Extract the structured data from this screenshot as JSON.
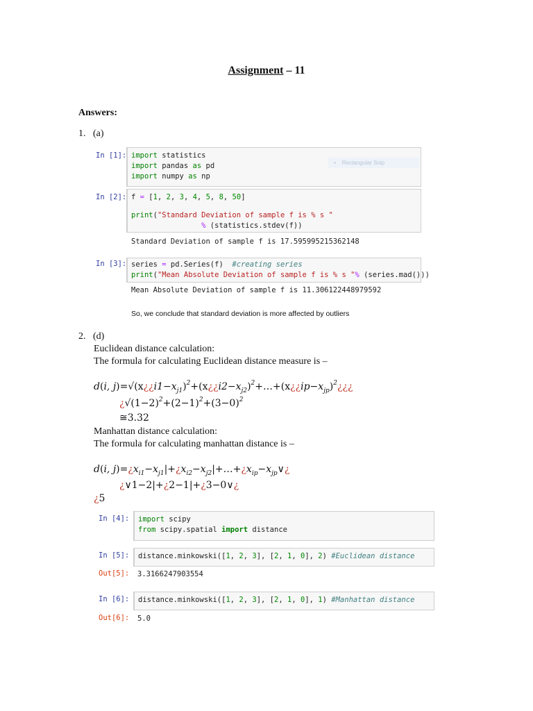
{
  "title": {
    "underlined": "Assignment",
    "rest": " – 11"
  },
  "answers_heading": "Answers:",
  "q1_label": "1.   (a)",
  "cells": {
    "in1": {
      "prompt": "In [1]:",
      "lines": [
        [
          [
            "import",
            "kwn"
          ],
          [
            " statistics",
            ""
          ]
        ],
        [
          [
            "import",
            "kwn"
          ],
          [
            " pandas ",
            ""
          ],
          [
            "as",
            "kwn"
          ],
          [
            " pd",
            ""
          ]
        ],
        [
          [
            "import",
            "kwn"
          ],
          [
            " numpy ",
            ""
          ],
          [
            "as",
            "kwn"
          ],
          [
            " np",
            ""
          ]
        ]
      ]
    },
    "in2": {
      "prompt": "In [2]:",
      "lines": [
        [
          [
            "f ",
            ""
          ],
          [
            "=",
            "op"
          ],
          [
            " [",
            ""
          ],
          [
            "1",
            "num"
          ],
          [
            ", ",
            ""
          ],
          [
            "2",
            "num"
          ],
          [
            ", ",
            ""
          ],
          [
            "3",
            "num"
          ],
          [
            ", ",
            ""
          ],
          [
            "4",
            "num"
          ],
          [
            ", ",
            ""
          ],
          [
            "5",
            "num"
          ],
          [
            ", ",
            ""
          ],
          [
            "8",
            "num"
          ],
          [
            ", ",
            ""
          ],
          [
            "50",
            "num"
          ],
          [
            "]",
            ""
          ]
        ],
        [
          [
            "",
            ""
          ]
        ],
        [
          [
            "print",
            "kwn"
          ],
          [
            "(",
            ""
          ],
          [
            "\"Standard Deviation of sample f is % s \"",
            "str"
          ]
        ],
        [
          [
            "                ",
            ""
          ],
          [
            "%",
            "op"
          ],
          [
            " (statistics.stdev(f))",
            ""
          ]
        ]
      ]
    },
    "out2": "Standard Deviation of sample f is 17.595995215362148",
    "in3": {
      "prompt": "In [3]:",
      "lines": [
        [
          [
            "series ",
            ""
          ],
          [
            "=",
            "op"
          ],
          [
            " pd.Series(f)  ",
            ""
          ],
          [
            "#creating series",
            "cm"
          ]
        ],
        [
          [
            "print",
            "kwn"
          ],
          [
            "(",
            ""
          ],
          [
            "\"Mean Absolute Deviation of sample f is % s \"",
            "str"
          ],
          [
            "%",
            "op"
          ],
          [
            " (series.mad()))",
            ""
          ]
        ]
      ]
    },
    "out3": "Mean Absolute Deviation of sample f is 11.306122448979592",
    "in4": {
      "prompt": "In [4]:",
      "lines": [
        [
          [
            "import",
            "kwn"
          ],
          [
            " scipy",
            ""
          ]
        ],
        [
          [
            "from",
            "kwn"
          ],
          [
            " scipy.spatial ",
            ""
          ],
          [
            "import",
            "kw"
          ],
          [
            " distance",
            ""
          ]
        ]
      ]
    },
    "in5": {
      "prompt": "In [5]:",
      "lines": [
        [
          [
            "distance.minkowski([",
            ""
          ],
          [
            "1",
            "num"
          ],
          [
            ", ",
            ""
          ],
          [
            "2",
            "num"
          ],
          [
            ", ",
            ""
          ],
          [
            "3",
            "num"
          ],
          [
            "], [",
            ""
          ],
          [
            "2",
            "num"
          ],
          [
            ", ",
            ""
          ],
          [
            "1",
            "num"
          ],
          [
            ", ",
            ""
          ],
          [
            "0",
            "num"
          ],
          [
            "], ",
            ""
          ],
          [
            "2",
            "num"
          ],
          [
            ") ",
            ""
          ],
          [
            "#Euclidean distance",
            "cm"
          ]
        ]
      ]
    },
    "out5_prompt": "Out[5]:",
    "out5": "3.3166247903554",
    "in6": {
      "prompt": "In [6]:",
      "lines": [
        [
          [
            "distance.minkowski([",
            ""
          ],
          [
            "1",
            "num"
          ],
          [
            ", ",
            ""
          ],
          [
            "2",
            "num"
          ],
          [
            ", ",
            ""
          ],
          [
            "3",
            "num"
          ],
          [
            "], [",
            ""
          ],
          [
            "2",
            "num"
          ],
          [
            ", ",
            ""
          ],
          [
            "1",
            "num"
          ],
          [
            ", ",
            ""
          ],
          [
            "0",
            "num"
          ],
          [
            "], ",
            ""
          ],
          [
            "1",
            "num"
          ],
          [
            ") ",
            ""
          ],
          [
            "#Manhattan distance",
            "cm"
          ]
        ]
      ]
    },
    "out6_prompt": "Out[6]:",
    "out6": "5.0"
  },
  "snip_overlay": "▪    Rectangular Snip",
  "conclusion": "So, we conclude that standard deviation is more affected by outliers",
  "q2_label": "2.   (d)",
  "euclid_heading": "Euclidean distance calculation:",
  "euclid_formula_intro": "The formula for calculating Euclidean distance measure is –",
  "euclid_formula": [
    [
      [
        "d",
        "",
        ""
      ],
      [
        "(",
        "up"
      ],
      [
        "i, j",
        "",
        ""
      ],
      [
        ")=√(x",
        "up"
      ],
      [
        "¿¿",
        "q"
      ],
      [
        "i1−x",
        "",
        ""
      ],
      [
        "j1",
        "sub"
      ],
      [
        ")",
        "up"
      ],
      [
        "2",
        "sup"
      ],
      [
        "+(x",
        "up"
      ],
      [
        "¿¿",
        "q"
      ],
      [
        "i2−x",
        ""
      ],
      [
        "j2",
        "sub"
      ],
      [
        ")",
        "up"
      ],
      [
        "2",
        "sup"
      ],
      [
        "+…+(x",
        "up"
      ],
      [
        "¿¿",
        "q"
      ],
      [
        "ip−x",
        ""
      ],
      [
        "jp",
        "sub"
      ],
      [
        ")",
        "up"
      ],
      [
        "2",
        "sup"
      ],
      [
        "¿¿¿",
        "q"
      ]
    ],
    [
      [
        "¿",
        "q"
      ],
      [
        "√(1−2)",
        "up"
      ],
      [
        "2",
        "sup"
      ],
      [
        "+(2−1)",
        "up"
      ],
      [
        "2",
        "sup"
      ],
      [
        "+(3−0)",
        "up"
      ],
      [
        "2",
        "sup"
      ]
    ],
    [
      [
        "≅3.32",
        "up"
      ]
    ]
  ],
  "manhattan_heading": "Manhattan distance calculation:",
  "manhattan_formula_intro": "The formula for calculating manhattan distance is –",
  "manhattan_formula": [
    [
      [
        "d",
        ""
      ],
      [
        "(",
        "up"
      ],
      [
        "i, j",
        ""
      ],
      [
        ")=",
        "up"
      ],
      [
        "¿",
        "q"
      ],
      [
        "x",
        ""
      ],
      [
        "i1",
        "sub"
      ],
      [
        "−x",
        ""
      ],
      [
        "j1",
        "sub"
      ],
      [
        "|+",
        "up"
      ],
      [
        "¿",
        "q"
      ],
      [
        "x",
        ""
      ],
      [
        "i2",
        "sub"
      ],
      [
        "−x",
        ""
      ],
      [
        "j2",
        "sub"
      ],
      [
        "|+…+",
        "up"
      ],
      [
        "¿",
        "q"
      ],
      [
        "x",
        ""
      ],
      [
        "ip",
        "sub"
      ],
      [
        "−x",
        ""
      ],
      [
        "jp",
        "sub"
      ],
      [
        "∨",
        "up"
      ],
      [
        "¿",
        "q"
      ]
    ],
    [
      [
        "¿",
        "q"
      ],
      [
        "∨1−2|+",
        "up"
      ],
      [
        "¿",
        "q"
      ],
      [
        "2−1|+",
        "up"
      ],
      [
        "¿",
        "q"
      ],
      [
        "3−0∨",
        "up"
      ],
      [
        "¿",
        "q"
      ]
    ],
    [
      [
        "¿",
        "q"
      ],
      [
        "5",
        "up"
      ]
    ]
  ]
}
